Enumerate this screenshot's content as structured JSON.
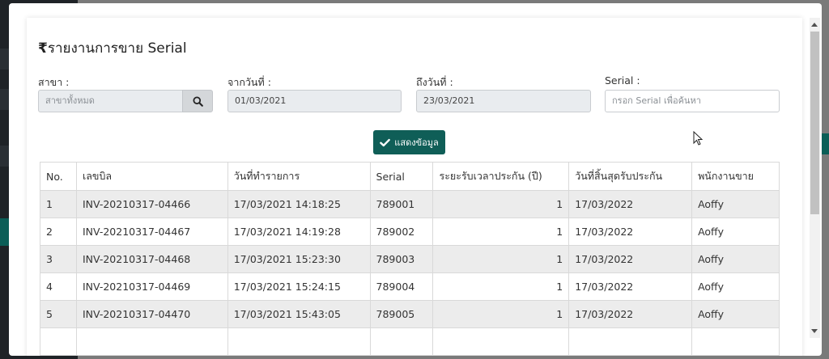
{
  "report": {
    "title_symbol": "₹",
    "title": "รายงานการขาย Serial"
  },
  "filters": {
    "branch_label": "สาขา :",
    "branch_value": "สาขาทั้งหมด",
    "from_label": "จากวันที่ :",
    "from_value": "01/03/2021",
    "to_label": "ถึงวันที่ :",
    "to_value": "23/03/2021",
    "serial_label": "Serial :",
    "serial_placeholder": "กรอก Serial เพื่อค้นหา",
    "show_button": "แสดงข้อมูล"
  },
  "table": {
    "headers": [
      "No.",
      "เลขบิล",
      "วันที่ทำรายการ",
      "Serial",
      "ระยะรับเวลาประกัน (ปี)",
      "วันที่สิ้นสุดรับประกัน",
      "พนักงานขาย"
    ],
    "rows": [
      [
        "1",
        "INV-20210317-04466",
        "17/03/2021 14:18:25",
        "789001",
        "1",
        "17/03/2022",
        "Aoffy"
      ],
      [
        "2",
        "INV-20210317-04467",
        "17/03/2021 14:19:28",
        "789002",
        "1",
        "17/03/2022",
        "Aoffy"
      ],
      [
        "3",
        "INV-20210317-04468",
        "17/03/2021 15:23:30",
        "789003",
        "1",
        "17/03/2022",
        "Aoffy"
      ],
      [
        "4",
        "INV-20210317-04469",
        "17/03/2021 15:24:15",
        "789004",
        "1",
        "17/03/2022",
        "Aoffy"
      ],
      [
        "5",
        "INV-20210317-04470",
        "17/03/2021 15:43:05",
        "789005",
        "1",
        "17/03/2022",
        "Aoffy"
      ]
    ]
  },
  "colors": {
    "accent": "#0f5e57",
    "row_alt": "#ececec"
  },
  "icons": {
    "search": "search-icon",
    "check": "check-icon"
  }
}
